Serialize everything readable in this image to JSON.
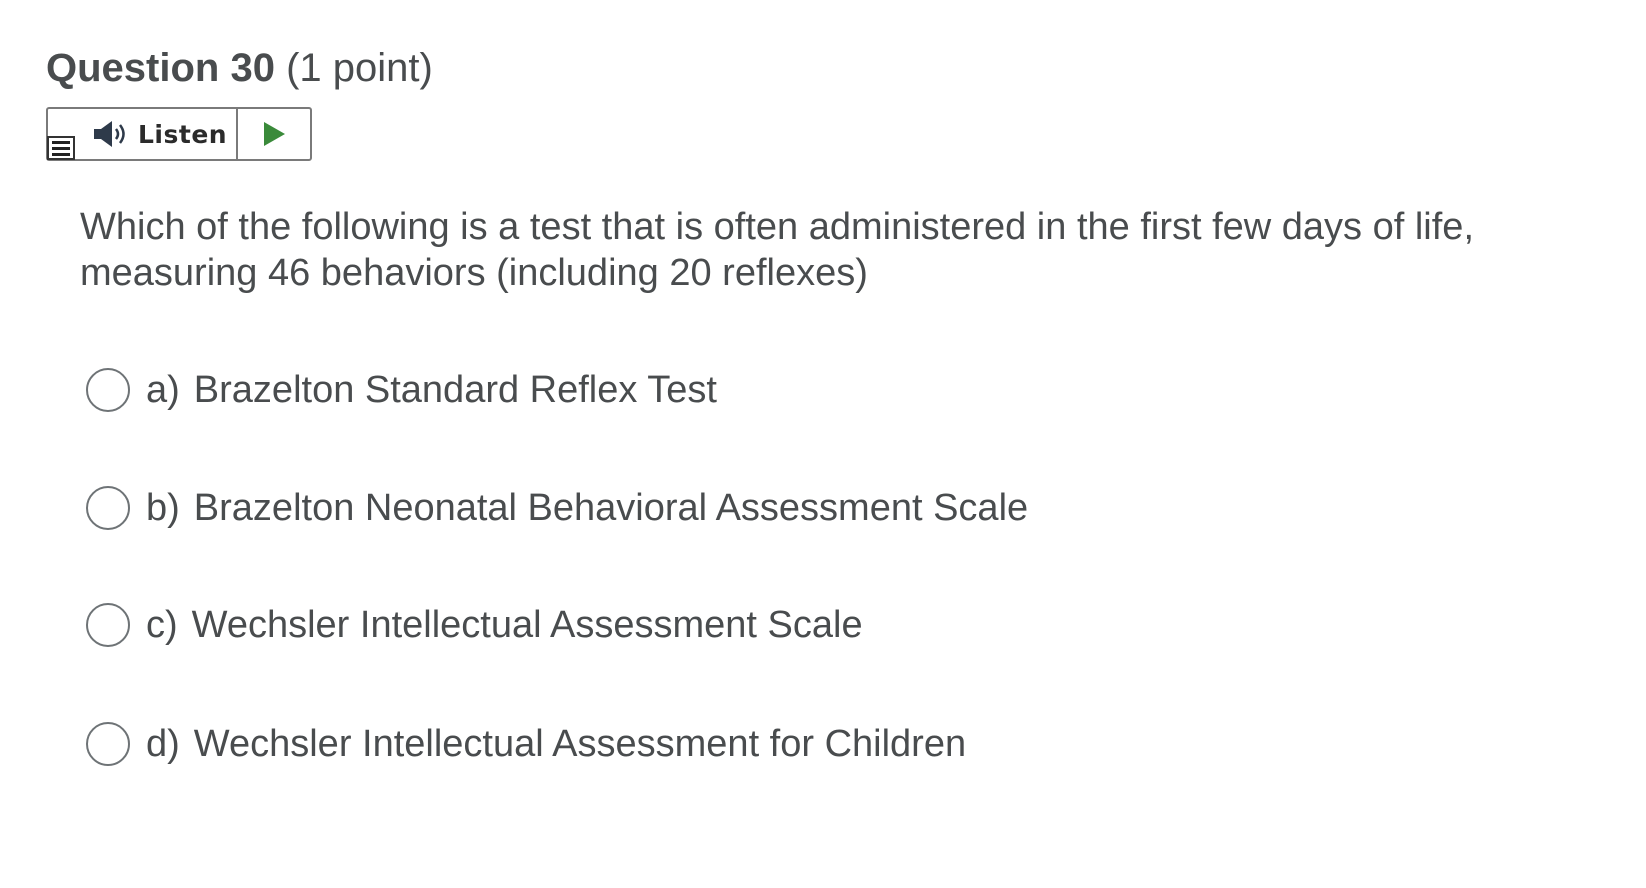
{
  "question": {
    "title": "Question 30",
    "points": "(1 point)",
    "text": "Which of the following is a test that is often administered in the first few days of life, measuring 46 behaviors (including 20 reflexes)"
  },
  "listen": {
    "label": "Listen",
    "speaker_icon": "speaker-icon",
    "play_icon": "play-icon",
    "menu_icon": "menu-icon",
    "play_color": "#3a8a3a"
  },
  "options": [
    {
      "letter": "a)",
      "text": "Brazelton Standard Reflex Test"
    },
    {
      "letter": "b)",
      "text": "Brazelton Neonatal Behavioral Assessment Scale"
    },
    {
      "letter": "c)",
      "text": "Wechsler Intellectual Assessment Scale"
    },
    {
      "letter": "d)",
      "text": "Wechsler Intellectual Assessment for Children"
    }
  ]
}
